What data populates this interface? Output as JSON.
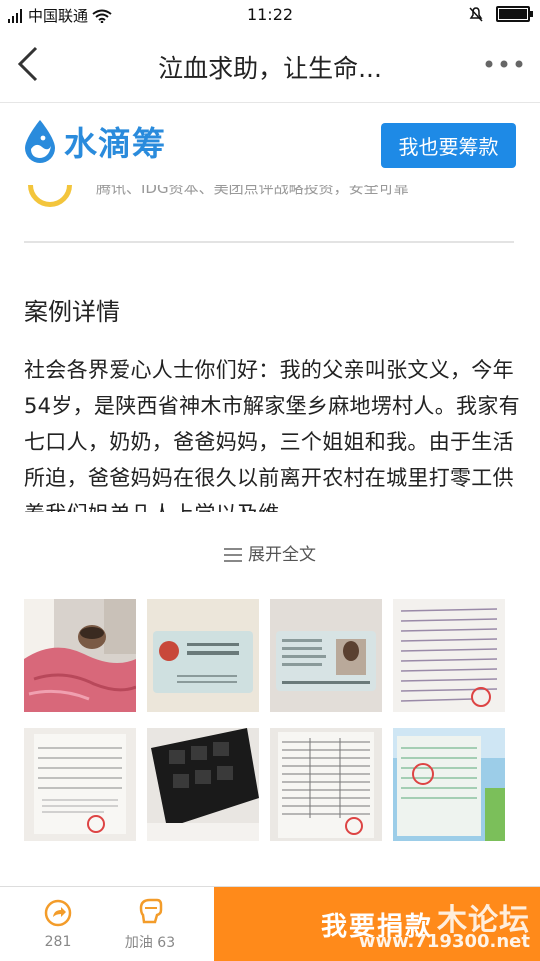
{
  "status_bar": {
    "signal_label": "中国联通",
    "time": "11:22",
    "battery_level": 0.92
  },
  "nav": {
    "title": "泣血求助，让生命...",
    "back_icon": "chevron-left-icon",
    "more_icon": "more-dots-icon"
  },
  "brand": {
    "name": "水滴筹",
    "logo_icon": "water-drop-icon",
    "cta": "我也要筹款",
    "accent": "#1e8ae6"
  },
  "partial_text": "腾讯、IDG资本、美团点评战略投资，安全可靠",
  "case": {
    "section_title": "案例详情",
    "story": "社会各界爱心人士你们好：我的父亲叫张文义，今年54岁，是陕西省神木市解家堡乡麻地塄村人。我家有七口人，奶奶，爸爸妈妈，三个姐姐和我。由于生活所迫，爸爸妈妈在很久以前离开农村在城里打零工供养我们姐弟几人上学以及维",
    "expand_label": "展开全文"
  },
  "photos": [
    {
      "type": "patient-in-bed"
    },
    {
      "type": "id-card-back",
      "text": "居民身份证"
    },
    {
      "type": "id-card-front"
    },
    {
      "type": "handwritten-letter"
    },
    {
      "type": "medical-form"
    },
    {
      "type": "ct-scan"
    },
    {
      "type": "hospital-record"
    },
    {
      "type": "receipt"
    }
  ],
  "bottom": {
    "share_count": "281",
    "cheer_label": "加油 63",
    "donate_label": "我要捐款",
    "watermark": "木论坛",
    "watermark_url": "www.719300.net",
    "donate_color": "#ff8a1a"
  }
}
